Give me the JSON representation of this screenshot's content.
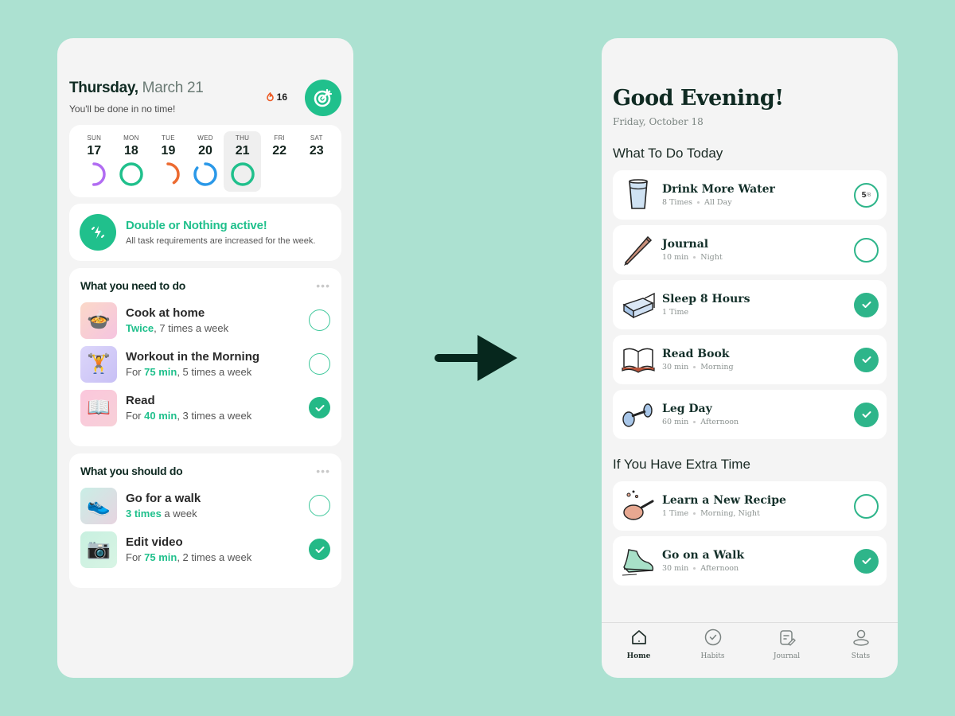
{
  "left_app": {
    "header": {
      "weekday": "Thursday,",
      "date": "March 21",
      "subtitle": "You'll be done in no time!",
      "streak_count": "16",
      "streak_icon": "flame-icon",
      "action_icon": "target-icon"
    },
    "week": [
      {
        "name": "SUN",
        "day": "17",
        "progress": 0.5,
        "color": "#b16cf2",
        "active": false
      },
      {
        "name": "MON",
        "day": "18",
        "progress": 1.0,
        "color": "#20c08c",
        "active": false
      },
      {
        "name": "TUE",
        "day": "19",
        "progress": 0.4,
        "color": "#ec6a30",
        "active": false
      },
      {
        "name": "WED",
        "day": "20",
        "progress": 0.85,
        "color": "#2a98e8",
        "active": false
      },
      {
        "name": "THU",
        "day": "21",
        "progress": 1.0,
        "color": "#20c08c",
        "active": true
      },
      {
        "name": "FRI",
        "day": "22",
        "progress": null,
        "color": null,
        "active": false
      },
      {
        "name": "SAT",
        "day": "23",
        "progress": null,
        "color": null,
        "active": false
      }
    ],
    "banner": {
      "title": "Double or Nothing active!",
      "text": "All task requirements are increased for the week.",
      "icon": "lightning-icon"
    },
    "need_to_do": {
      "heading": "What you need to do",
      "more": "•••",
      "items": [
        {
          "name": "Cook at home",
          "pre": "",
          "highlight": "Twice",
          "post": ", 7 times a week",
          "done": false,
          "icon": "cooking-pot-icon",
          "emoji": "🍲",
          "bg": "linear-gradient(135deg,#fbd8c8,#f5c4e0)"
        },
        {
          "name": "Workout in the Morning",
          "pre": "For ",
          "highlight": "75 min",
          "post": ", 5 times a week",
          "done": false,
          "icon": "dumbbell-icon",
          "emoji": "🏋️",
          "bg": "linear-gradient(135deg,#dcd6fa,#c8c0f5)"
        },
        {
          "name": "Read",
          "pre": "For ",
          "highlight": "40 min",
          "post": ", 3 times a week",
          "done": true,
          "icon": "open-book-icon",
          "emoji": "📖",
          "bg": "linear-gradient(135deg,#fbc7dc,#f7d0d8)"
        }
      ]
    },
    "should_do": {
      "heading": "What you should do",
      "more": "•••",
      "items": [
        {
          "name": "Go for a walk",
          "pre": "",
          "highlight": "3 times",
          "post": " a week",
          "done": false,
          "icon": "sneaker-icon",
          "emoji": "👟",
          "bg": "linear-gradient(135deg,#c9eee6,#e7d4e0)"
        },
        {
          "name": "Edit video",
          "pre": "For ",
          "highlight": "75 min",
          "post": ", 2 times a week",
          "done": true,
          "icon": "camera-icon",
          "emoji": "📷",
          "bg": "linear-gradient(135deg,#c8f0e0,#d8f4e4)"
        }
      ]
    }
  },
  "right_app": {
    "greeting": "Good Evening!",
    "date": "Friday, October 18",
    "today_section": "What To Do Today",
    "extra_section": "If You Have Extra Time",
    "today": [
      {
        "name": "Drink More Water",
        "meta": [
          "8 Times",
          "All Day"
        ],
        "status": "count",
        "count_done": "5",
        "count_total": "/8",
        "icon": "water-glass-icon"
      },
      {
        "name": "Journal",
        "meta": [
          "10 min",
          "Night"
        ],
        "status": "empty",
        "icon": "pencil-icon"
      },
      {
        "name": "Sleep 8 Hours",
        "meta": [
          "1 Time"
        ],
        "status": "done",
        "icon": "bed-icon"
      },
      {
        "name": "Read Book",
        "meta": [
          "30 min",
          "Morning"
        ],
        "status": "done",
        "icon": "book-icon"
      },
      {
        "name": "Leg Day",
        "meta": [
          "60 min",
          "Afternoon"
        ],
        "status": "done",
        "icon": "dumbbell-icon"
      }
    ],
    "extra": [
      {
        "name": "Learn a New Recipe",
        "meta": [
          "1 Time",
          "Morning, Night"
        ],
        "status": "empty",
        "icon": "frying-pan-icon"
      },
      {
        "name": "Go on a Walk",
        "meta": [
          "30 min",
          "Afternoon"
        ],
        "status": "done",
        "icon": "shoe-icon"
      }
    ],
    "tabs": [
      {
        "label": "Home",
        "icon": "home-icon",
        "active": true
      },
      {
        "label": "Habits",
        "icon": "check-circle-icon",
        "active": false
      },
      {
        "label": "Journal",
        "icon": "journal-icon",
        "active": false
      },
      {
        "label": "Stats",
        "icon": "user-icon",
        "active": false
      }
    ]
  },
  "colors": {
    "background": "#ace1d1",
    "accent": "#20c08c",
    "dark": "#0f2a22"
  }
}
